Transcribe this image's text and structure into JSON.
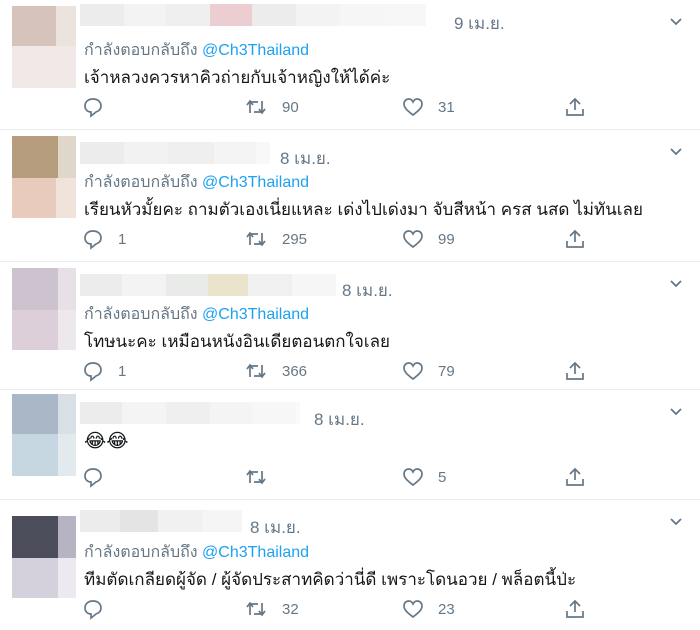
{
  "tweets": [
    {
      "date": "9 เม.ย.",
      "reply_prefix": "กำลังตอบกลับถึง",
      "reply_handle": "@Ch3Thailand",
      "text": "เจ้าหลวงควรหาคิวถ่ายกับเจ้าหญิงให้ได้ค่ะ",
      "replies": "",
      "retweets": "90",
      "likes": "31"
    },
    {
      "date": "8 เม.ย.",
      "reply_prefix": "กำลังตอบกลับถึง",
      "reply_handle": "@Ch3Thailand",
      "text": "เรียนหัวมั้ยคะ  ถามตัวเองเนี่ยแหละ  เด่งไปเด่งมา  จับสีหน้า  ครส  นสด  ไม่ทันเลย",
      "replies": "1",
      "retweets": "295",
      "likes": "99"
    },
    {
      "date": "8 เม.ย.",
      "reply_prefix": "กำลังตอบกลับถึง",
      "reply_handle": "@Ch3Thailand",
      "text": "โทษนะคะ  เหมือนหนังอินเดียตอนตกใจเลย",
      "replies": "1",
      "retweets": "366",
      "likes": "79"
    },
    {
      "date": "8 เม.ย.",
      "text": "😂😂",
      "replies": "",
      "retweets": "",
      "likes": "5"
    },
    {
      "date": "8 เม.ย.",
      "reply_prefix": "กำลังตอบกลับถึง",
      "reply_handle": "@Ch3Thailand",
      "text": "ทีมตัดเกลียดผู้จัด / ผู้จัดประสาทคิดว่านี่ดี  เพราะโดนอวย / พล็อตนี้ป่ะ",
      "replies": "",
      "retweets": "32",
      "likes": "23"
    }
  ],
  "icons": {
    "reply": "reply-icon",
    "retweet": "retweet-icon",
    "like": "heart-icon",
    "share": "share-icon",
    "more": "chevron-down-icon"
  },
  "colors": {
    "handle": "#1da1f2",
    "muted": "#657786",
    "text": "#14171a",
    "divider": "#e6ecf0"
  }
}
